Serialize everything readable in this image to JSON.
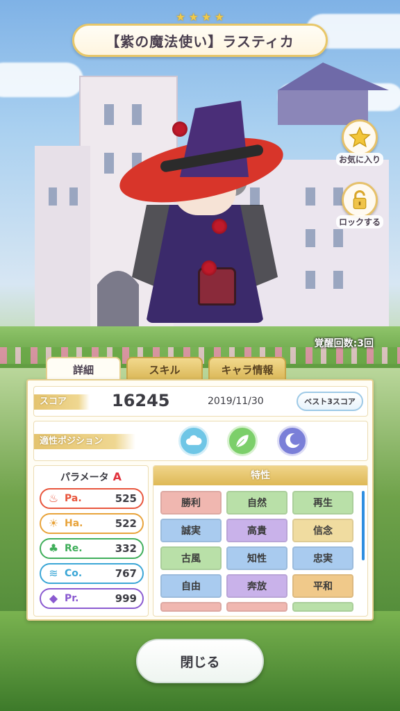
{
  "header": {
    "rarity_stars": [
      "★",
      "★",
      "★",
      "★"
    ],
    "title": "【紫の魔法使い】ラスティカ"
  },
  "side_buttons": {
    "favorite_label": "お気に入り",
    "lock_label": "ロックする"
  },
  "awaken_text": "覚醒回数:3回",
  "tabs": [
    {
      "label": "詳細"
    },
    {
      "label": "スキル"
    },
    {
      "label": "キャラ情報"
    }
  ],
  "score": {
    "label": "スコア",
    "value": "16245",
    "date": "2019/11/30",
    "best3_label": "ベスト3スコア"
  },
  "position": {
    "label": "適性ポジション",
    "icons": [
      "cloud-icon",
      "leaf-icon",
      "moon-icon"
    ],
    "icon_colors": [
      "#6fc6e6",
      "#7ccf6a",
      "#7a7fd8"
    ]
  },
  "parameters": {
    "title": "パラメータ",
    "rank": "A",
    "items": [
      {
        "name": "Pa.",
        "value": "525",
        "color": "#e8553c",
        "icon": "flame-icon",
        "glyph": "♨"
      },
      {
        "name": "Ha.",
        "value": "522",
        "color": "#e8a33a",
        "icon": "sun-icon",
        "glyph": "☀"
      },
      {
        "name": "Re.",
        "value": "332",
        "color": "#3fae5a",
        "icon": "clover-icon",
        "glyph": "♣"
      },
      {
        "name": "Co.",
        "value": "767",
        "color": "#3aa6d6",
        "icon": "wind-icon",
        "glyph": "≋"
      },
      {
        "name": "Pr.",
        "value": "999",
        "color": "#8a5ad0",
        "icon": "diamond-icon",
        "glyph": "◆"
      }
    ]
  },
  "traits": {
    "title": "特性",
    "items": [
      {
        "label": "勝利",
        "color": "#f0b7b0"
      },
      {
        "label": "自然",
        "color": "#b9e0a8"
      },
      {
        "label": "再生",
        "color": "#b9e0a8"
      },
      {
        "label": "誠実",
        "color": "#a9cbef"
      },
      {
        "label": "高貴",
        "color": "#c9b2ea"
      },
      {
        "label": "信念",
        "color": "#f0dca0"
      },
      {
        "label": "古風",
        "color": "#b9e0a8"
      },
      {
        "label": "知性",
        "color": "#a9cbef"
      },
      {
        "label": "忠実",
        "color": "#a9cbef"
      },
      {
        "label": "自由",
        "color": "#a9cbef"
      },
      {
        "label": "奔放",
        "color": "#c9b2ea"
      },
      {
        "label": "平和",
        "color": "#f0c98a"
      },
      {
        "label": "",
        "color": "#f0b7b0"
      },
      {
        "label": "",
        "color": "#f0b7b0"
      },
      {
        "label": "",
        "color": "#b9e0a8"
      }
    ]
  },
  "close_label": "閉じる"
}
